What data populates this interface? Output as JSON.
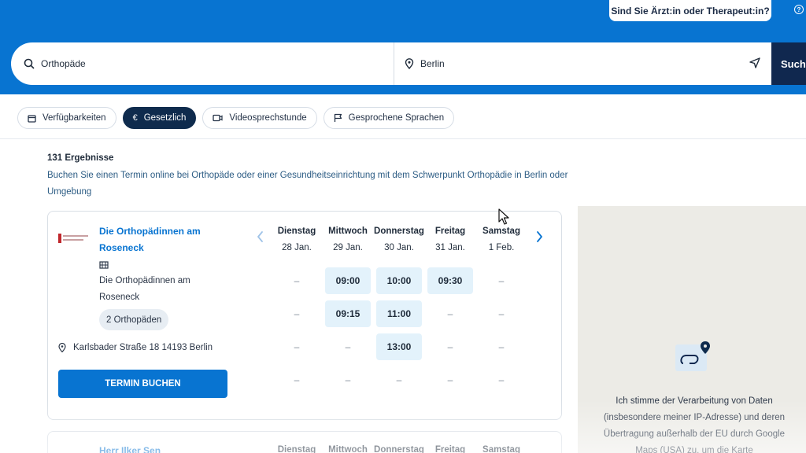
{
  "header": {
    "pro_button": "Sind Sie Ärzt:in oder Therapeut:in?",
    "help_glyph": "?"
  },
  "search": {
    "query": "Orthopäde",
    "location": "Berlin",
    "button": "Such"
  },
  "filters": [
    {
      "label": "Verfügbarkeiten",
      "icon": "calendar-icon",
      "active": false
    },
    {
      "label": "Gesetzlich",
      "icon": "euro-icon",
      "active": true
    },
    {
      "label": "Videosprechstunde",
      "icon": "video-icon",
      "active": false
    },
    {
      "label": "Gesprochene Sprachen",
      "icon": "flag-icon",
      "active": false
    }
  ],
  "results": {
    "count": "131 Ergebnisse",
    "description": "Buchen Sie einen Termin online bei Orthopäde oder einer Gesundheitseinrichtung mit dem Schwerpunkt Orthopädie in Berlin oder Umgebung"
  },
  "card": {
    "name": "Die Orthopädinnen am Roseneck",
    "practice": "Die Orthopädinnen am Roseneck",
    "badge": "2 Orthopäden",
    "address": "Karlsbader Straße 18 14193 Berlin",
    "book_button": "TERMIN BUCHEN",
    "days": [
      {
        "name": "Dienstag",
        "date": "28 Jan.",
        "slots": [
          "–",
          "–",
          "–",
          "–"
        ]
      },
      {
        "name": "Mittwoch",
        "date": "29 Jan.",
        "slots": [
          "09:00",
          "09:15",
          "–",
          "–"
        ]
      },
      {
        "name": "Donnerstag",
        "date": "30 Jan.",
        "slots": [
          "10:00",
          "11:00",
          "13:00",
          "–"
        ]
      },
      {
        "name": "Freitag",
        "date": "31 Jan.",
        "slots": [
          "09:30",
          "–",
          "–",
          "–"
        ]
      },
      {
        "name": "Samstag",
        "date": "1 Feb.",
        "slots": [
          "–",
          "–",
          "–",
          "–"
        ]
      }
    ]
  },
  "next_card": {
    "name": "Herr Ilker Sen",
    "days": [
      "Dienstag",
      "Mittwoch",
      "Donnerstag",
      "Freitag",
      "Samstag"
    ]
  },
  "map": {
    "consent_text": "Ich stimme der Verarbeitung von Daten (insbesondere meiner IP-Adresse) und deren Übertragung außerhalb der EU durch Google Maps (USA) zu, um die Karte"
  },
  "colors": {
    "brand_blue": "#0874d1",
    "navy": "#0f2b4d",
    "slot_bg": "#e3f2fb"
  }
}
